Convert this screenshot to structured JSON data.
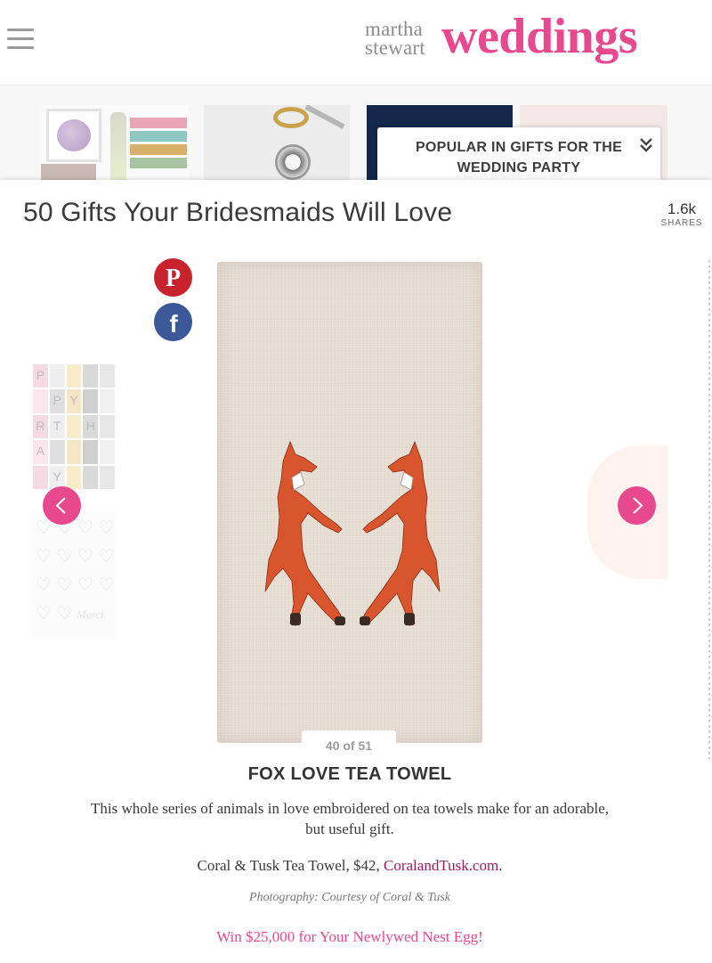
{
  "header": {
    "brand_small": "martha\nstewart",
    "brand_large": "weddings",
    "brand_color": "#e8488e",
    "menu_icon": "hamburger-icon"
  },
  "popular": {
    "title": "POPULAR IN GIFTS FOR THE WEDDING PARTY",
    "chevron_icon": "chevron-double-down-icon"
  },
  "article": {
    "title": "50 Gifts Your Bridesmaids Will Love",
    "shares_count": "1.6k",
    "shares_label": "SHARES"
  },
  "social": {
    "pinterest_icon": "pinterest-icon",
    "facebook_icon": "facebook-icon"
  },
  "slide": {
    "counter": "40 of 51",
    "title": "FOX LOVE TEA TOWEL",
    "description": "This whole series of animals in love embroidered on tea towels make for an adorable, but useful gift.",
    "price_text": "Coral & Tusk Tea Towel, $42, ",
    "shop_link": "CoralandTusk.com",
    "price_suffix": ".",
    "credit": "Photography: Courtesy of Coral & Tusk"
  },
  "promo": {
    "text": "Win $25,000 for Your Newlywed Nest Egg!"
  },
  "nav": {
    "prev_icon": "chevron-left-icon",
    "next_icon": "chevron-right-icon"
  },
  "calendar_letters": [
    "P",
    "",
    "",
    "",
    "",
    "",
    "P",
    "Y",
    "",
    "",
    "R",
    "T",
    "",
    "H",
    "",
    "A",
    "",
    "",
    "",
    "",
    "",
    "Y",
    "",
    "",
    ""
  ],
  "hearts_text": "Merci"
}
